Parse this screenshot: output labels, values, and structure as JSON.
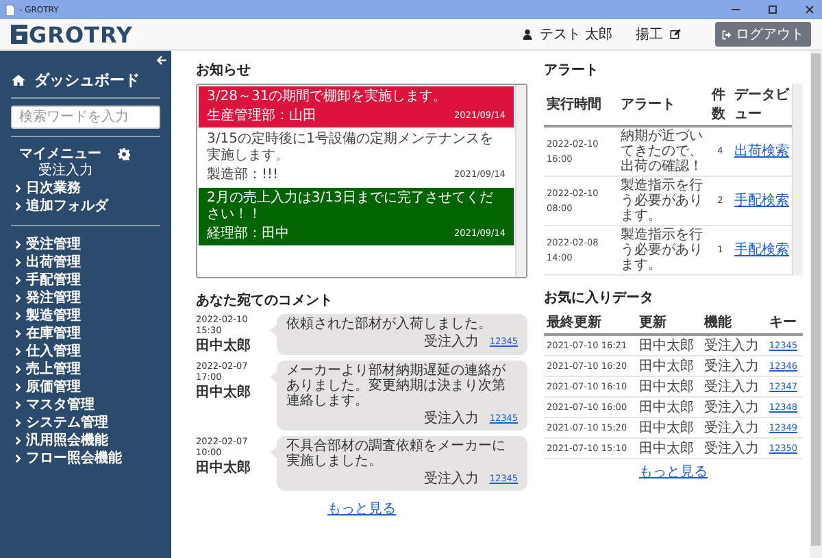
{
  "window": {
    "title": "- GROTRY"
  },
  "header": {
    "logo": "GROTRY",
    "user": "テスト 太郎",
    "role": "揚工",
    "logout": "ログアウト"
  },
  "sidebar": {
    "dashboard": "ダッシュボード",
    "search": {
      "placeholder": "検索ワードを入力"
    },
    "my_menu": {
      "title": "マイメニュー",
      "items": [
        "受注入力"
      ]
    },
    "folders": [
      "日次業務",
      "追加フォルダ"
    ],
    "menu": [
      "受注管理",
      "出荷管理",
      "手配管理",
      "発注管理",
      "製造管理",
      "在庫管理",
      "仕入管理",
      "売上管理",
      "原価管理",
      "マスタ管理",
      "システム管理",
      "汎用照会機能",
      "フロー照会機能"
    ]
  },
  "notices": {
    "title": "お知らせ",
    "items": [
      {
        "message": "3/28～31の期間で棚卸を実施します。",
        "author": "生産管理部：山田",
        "date": "2021/09/14",
        "color": "#dc143c"
      },
      {
        "message": "3/15の定時後に1号設備の定期メンテナンスを実施します。",
        "author": "製造部：!!!",
        "date": "2021/09/14",
        "color": "#ffffff"
      },
      {
        "message": "2月の売上入力は3/13日までに完了させてください！！",
        "author": "経理部：田中",
        "date": "2021/09/14",
        "color": "#006400"
      }
    ]
  },
  "alerts": {
    "title": "アラート",
    "columns": [
      "実行時間",
      "アラート",
      "件数",
      "データビュー"
    ],
    "rows": [
      {
        "time": "2022-02-10 16:00",
        "message": "納期が近づいてきたので、出荷の確認！",
        "count": "4",
        "link": "出荷検索"
      },
      {
        "time": "2022-02-10 08:00",
        "message": "製造指示を行う必要があります。",
        "count": "2",
        "link": "手配検索"
      },
      {
        "time": "2022-02-08 14:00",
        "message": "製造指示を行う必要があります。",
        "count": "1",
        "link": "手配検索"
      }
    ]
  },
  "comments": {
    "title": "あなた宛てのコメント",
    "items": [
      {
        "time": "2022-02-10 15:30",
        "author": "田中太郎",
        "message": "依頼された部材が入荷しました。",
        "function": "受注入力",
        "key": "12345"
      },
      {
        "time": "2022-02-07 17:00",
        "author": "田中太郎",
        "message": "メーカーより部材納期遅延の連絡がありました。変更納期は決まり次第連絡します。",
        "function": "受注入力",
        "key": "12345"
      },
      {
        "time": "2022-02-07 10:00",
        "author": "田中太郎",
        "message": "不具合部材の調査依頼をメーカーに実施しました。",
        "function": "受注入力",
        "key": "12345"
      }
    ],
    "more": "もっと見る"
  },
  "favorites": {
    "title": "お気に入りデータ",
    "columns": [
      "最終更新",
      "更新",
      "機能",
      "キー"
    ],
    "rows": [
      {
        "updated": "2021-07-10 16:21",
        "user": "田中太郎",
        "function": "受注入力",
        "key": "12345"
      },
      {
        "updated": "2021-07-10 16:20",
        "user": "田中太郎",
        "function": "受注入力",
        "key": "12346"
      },
      {
        "updated": "2021-07-10 16:10",
        "user": "田中太郎",
        "function": "受注入力",
        "key": "12347"
      },
      {
        "updated": "2021-07-10 16:00",
        "user": "田中太郎",
        "function": "受注入力",
        "key": "12348"
      },
      {
        "updated": "2021-07-10 15:20",
        "user": "田中太郎",
        "function": "受注入力",
        "key": "12349"
      },
      {
        "updated": "2021-07-10 15:10",
        "user": "田中太郎",
        "function": "受注入力",
        "key": "12350"
      }
    ],
    "more": "もっと見る"
  }
}
